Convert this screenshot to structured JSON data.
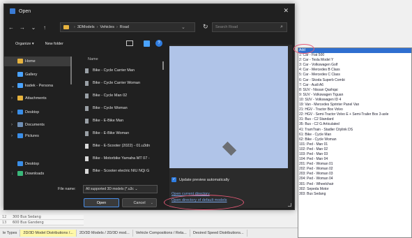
{
  "dialog": {
    "title": "Open",
    "close": "✕",
    "nav": {
      "back": "←",
      "forward": "→",
      "dropdown": "⌄",
      "up": "↑"
    },
    "breadcrumb": [
      "3DModels",
      "Vehicles",
      "Road"
    ],
    "breadcrumb_sep": "›",
    "breadcrumb_lead": "›",
    "addr_chevron": "⌄",
    "refresh": "↻",
    "search_placeholder": "Search Road",
    "search_icon": "⌕",
    "organize": "Organize ▾",
    "new_folder": "New folder",
    "help": "?",
    "nav_items": [
      {
        "label": "Home",
        "icon": "home-icon",
        "color": "#e7b33e",
        "arrow": ""
      },
      {
        "label": "Gallery",
        "icon": "gallery-icon",
        "color": "#4aa3ff",
        "arrow": ""
      },
      {
        "label": "kadek - Persona",
        "icon": "cloud-icon",
        "color": "#4aa3ff",
        "arrow": "⌄"
      },
      {
        "label": "Attachments",
        "icon": "folder-icon",
        "color": "#e7b33e",
        "arrow": "›"
      },
      {
        "label": "Desktop",
        "icon": "desktop-icon",
        "color": "#3a8ee8",
        "arrow": "›"
      },
      {
        "label": "Documents",
        "icon": "documents-icon",
        "color": "#6f8fb5",
        "arrow": "›"
      },
      {
        "label": "Pictures",
        "icon": "pictures-icon",
        "color": "#3a8ee8",
        "arrow": "›"
      }
    ],
    "nav_items_lower": [
      {
        "label": "Desktop",
        "icon": "desktop-icon",
        "color": "#3a8ee8",
        "arrow": ""
      },
      {
        "label": "Downloads",
        "icon": "downloads-icon",
        "color": "#3ab87a",
        "arrow": "↓"
      }
    ],
    "column_name": "Name",
    "files": [
      {
        "name": "Bike - Cycle Carrier Man",
        "icon": "model-file-icon"
      },
      {
        "name": "Bike - Cycle Carrier Woman",
        "icon": "model-file-icon"
      },
      {
        "name": "Bike - Cycle Man 02",
        "icon": "model-file-icon"
      },
      {
        "name": "Bike - Cycle Woman",
        "icon": "model-file-icon"
      },
      {
        "name": "Bike - E-Bike Man",
        "icon": "model-file-icon"
      },
      {
        "name": "Bike - E-Bike Woman",
        "icon": "model-file-icon"
      },
      {
        "name": "Bike - E-Scooter (2022) - 01.u3dn",
        "icon": "file-icon"
      },
      {
        "name": "Bike - Motorbike Yamaha MT 07 -",
        "icon": "file-icon"
      },
      {
        "name": "Bike - Scooter electric NIU NQi G",
        "icon": "file-icon"
      }
    ],
    "preview_checkbox": "Update preview automatically",
    "checkmark": "✓",
    "link_current": "Open current directory",
    "link_default": "Open directory of default models",
    "file_name_label": "File name:",
    "file_type": "All supported 3D models (*.u3c ⌄",
    "open_button": "Open",
    "cancel_button": "Cancel",
    "cancel_chevron": "⌄"
  },
  "dropdown": {
    "items": [
      "Add",
      "1: Car - Fiat 500",
      "2: Car - Tesla Model Y",
      "3: Car - Volkswagen Golf",
      "4: Car - Mercedes B Class",
      "5: Car - Mercedes C Class",
      "6: Car - Skoda Superb Combi",
      "7: Car - Audi A6",
      "8: SUV - Nissan Qashqai",
      "9: SUV - Volkswagen Tiguan",
      "10: SUV - Volkswagen ID 4",
      "19: Van - Mercedes Sprinter Panel Van",
      "21: HGV - Tractor Box Volvo",
      "22: HGV - Semi-Tractor Volvo E + Semi-Trailer Box 3-axle",
      "31: Bus - C2 Standard",
      "35: Bus - C2 G Articulated",
      "41: TramTrain - Stadler Citylink DS",
      "61: Bike - Cycle Man",
      "62: Bike - Cycle Woman",
      "101: Ped - Man 01",
      "102: Ped - Man 02",
      "103: Ped - Man 03",
      "104: Ped - Man 04",
      "201: Ped - Woman 01",
      "202: Ped - Woman 02",
      "203: Ped - Woman 03",
      "204: Ped - Woman 04",
      "301: Ped - Wheelchair",
      "302: Sepeda Motor",
      "303: Bus Sedang"
    ]
  },
  "background": {
    "rows": [
      {
        "num": "12",
        "label": "300 Bus Sedang"
      },
      {
        "num": "13",
        "label": "600 Bus Gandeng"
      }
    ],
    "tabs": [
      {
        "label": "le Types",
        "active": false
      },
      {
        "label": "2D/3D Model Distributions /...",
        "active": true
      },
      {
        "label": "2D/3D Models / 2D/3D mod...",
        "active": false
      },
      {
        "label": "Vehicle Compositions / Rela...",
        "active": false
      },
      {
        "label": "Desired Speed Distributions...",
        "active": false
      }
    ]
  }
}
